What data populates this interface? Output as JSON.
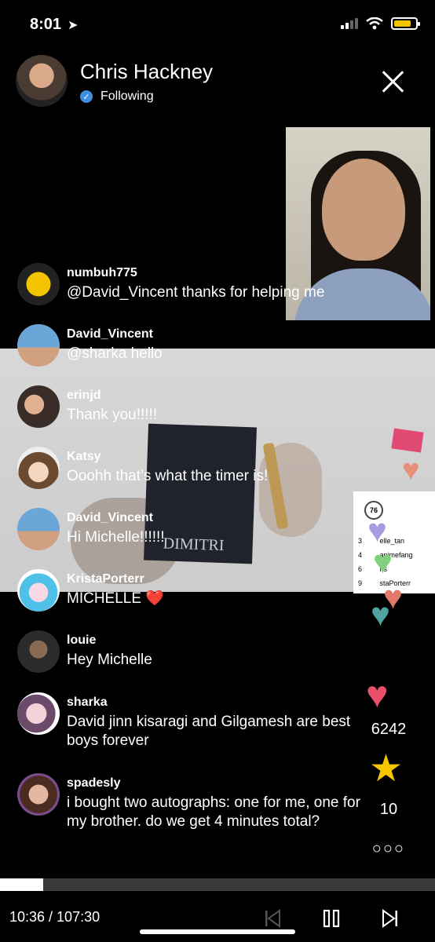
{
  "status_bar": {
    "time": "8:01"
  },
  "host": {
    "name": "Chris Hackney",
    "status": "Following"
  },
  "leaderboard": {
    "badge": "76",
    "rows": [
      {
        "rank": "3",
        "user": "elle_tan"
      },
      {
        "rank": "4",
        "user": "animefang"
      },
      {
        "rank": "6",
        "user": "ns"
      },
      {
        "rank": "9",
        "user": "staPorterr"
      }
    ]
  },
  "stream_card_text": "DIMITRI",
  "chat": [
    {
      "user": "numbuh775",
      "text": "@David_Vincent thanks for helping me"
    },
    {
      "user": "David_Vincent",
      "text": "@sharka hello"
    },
    {
      "user": "erinjd",
      "text": "Thank you!!!!!"
    },
    {
      "user": "Katsy",
      "text": "Ooohh that’s what the timer is!"
    },
    {
      "user": "David_Vincent",
      "text": "Hi Michelle!!!!!!"
    },
    {
      "user": "KristaPorterr",
      "text": "MICHELLE ❤️"
    },
    {
      "user": "louie",
      "text": "Hey Michelle"
    },
    {
      "user": "sharka",
      "text": "David jinn kisaragi and Gilgamesh are best boys forever"
    },
    {
      "user": "spadesly",
      "text": "i bought two autographs: one for me, one for my brother. do we get 4 minutes total?"
    }
  ],
  "reactions": {
    "hearts_count": "6242",
    "stars_count": "10"
  },
  "playback": {
    "position": "10:36 / 107:30",
    "progress_fraction": 0.099
  },
  "colors": {
    "accent": "#3f8fe0",
    "eraser": "#ee4f7a",
    "star": "#f7c600"
  }
}
